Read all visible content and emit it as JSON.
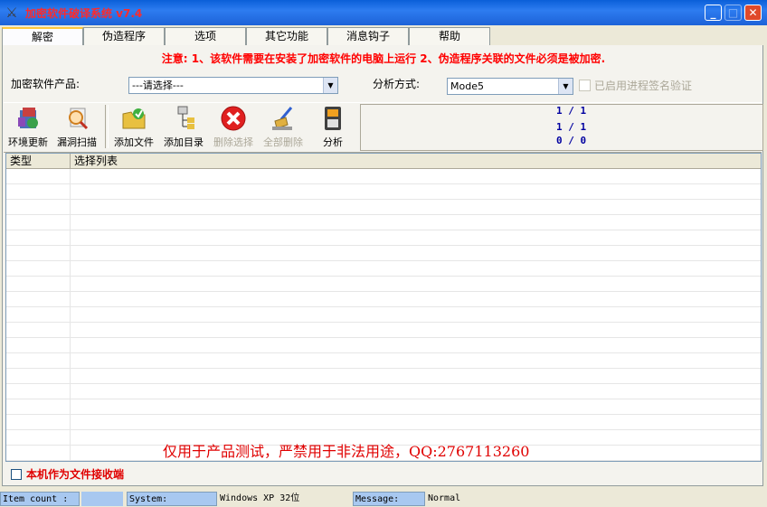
{
  "window": {
    "title": "加密软件破译系统 v7.4"
  },
  "tabs": [
    {
      "label": "解密"
    },
    {
      "label": "伪造程序"
    },
    {
      "label": "选项"
    },
    {
      "label": "其它功能"
    },
    {
      "label": "消息钩子"
    },
    {
      "label": "帮助"
    }
  ],
  "notice": "注意: 1、该软件需要在安装了加密软件的电脑上运行 2、伪造程序关联的文件必须是被加密.",
  "product": {
    "label": "加密软件产品:",
    "value": "---请选择---"
  },
  "analysis": {
    "label": "分析方式:",
    "value": "Mode5"
  },
  "signature_check": {
    "label": "已启用进程签名验证",
    "checked": false
  },
  "toolbar": [
    {
      "label": "环境更新",
      "icon": "env-update-icon",
      "enabled": true
    },
    {
      "label": "漏洞扫描",
      "icon": "scan-icon",
      "enabled": true
    },
    {
      "label": "添加文件",
      "icon": "add-file-icon",
      "enabled": true
    },
    {
      "label": "添加目录",
      "icon": "add-dir-icon",
      "enabled": true
    },
    {
      "label": "删除选择",
      "icon": "delete-icon",
      "enabled": false
    },
    {
      "label": "全部删除",
      "icon": "clear-icon",
      "enabled": false
    },
    {
      "label": "分析",
      "icon": "analyze-icon",
      "enabled": true
    }
  ],
  "counters": [
    "1 / 1",
    "1 / 1",
    "0 / 0"
  ],
  "list": {
    "columns": [
      "类型",
      "选择列表"
    ]
  },
  "warning": "仅用于产品测试，严禁用于非法用途，QQ:2767113260",
  "receiver": {
    "label": "本机作为文件接收端",
    "checked": false
  },
  "statusbar": {
    "item_count_label": "Item count :",
    "item_count_value": "",
    "system_label": "System:",
    "system_value": "Windows XP 32位",
    "message_label": "Message:",
    "message_value": "Normal"
  }
}
